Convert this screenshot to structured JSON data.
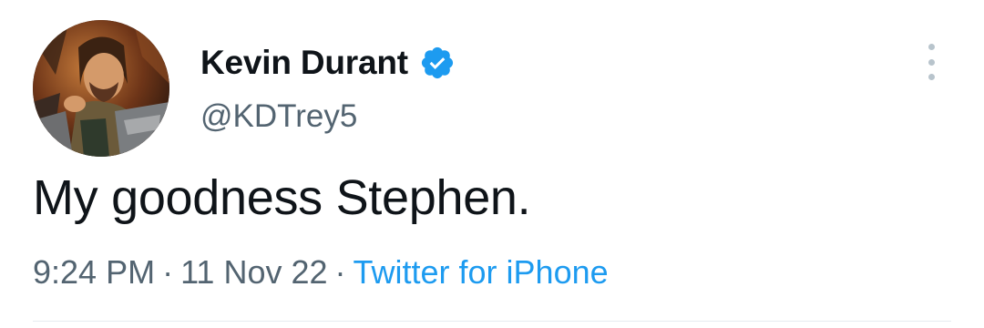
{
  "tweet": {
    "author": {
      "display_name": "Kevin Durant",
      "handle": "@KDTrey5",
      "verified": true
    },
    "text": "My goodness Stephen.",
    "time": "9:24 PM",
    "date": "11 Nov 22",
    "separator": "·",
    "source": "Twitter for iPhone"
  },
  "colors": {
    "text_primary": "#0f1419",
    "text_secondary": "#536471",
    "accent": "#1d9bf0"
  },
  "icons": {
    "verified": "verified-badge-icon",
    "more": "more-options-icon"
  }
}
